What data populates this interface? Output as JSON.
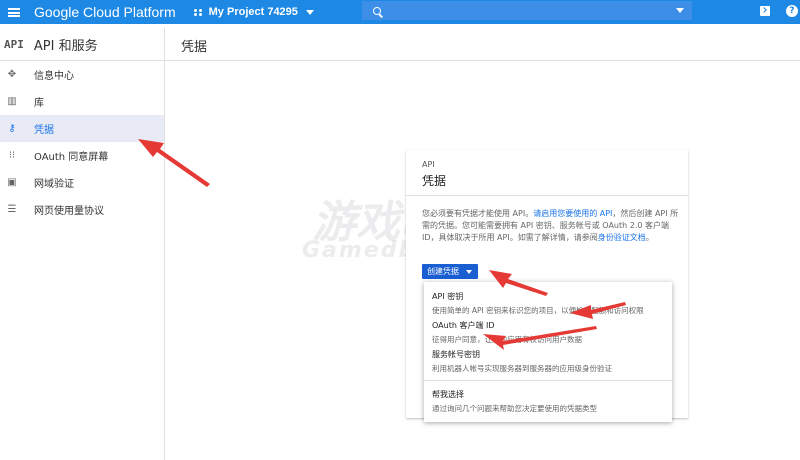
{
  "topbar": {
    "brand": "Google Cloud Platform",
    "project": "My Project 74295",
    "search_placeholder": ""
  },
  "sidebar": {
    "title": "API 和服务",
    "logo_text": "API",
    "items": [
      {
        "label": "信息中心",
        "icon": "dashboard-icon"
      },
      {
        "label": "库",
        "icon": "library-icon"
      },
      {
        "label": "凭据",
        "icon": "key-icon",
        "active": true
      },
      {
        "label": "OAuth 同意屏幕",
        "icon": "consent-icon"
      },
      {
        "label": "网域验证",
        "icon": "domain-icon"
      },
      {
        "label": "网页使用量协议",
        "icon": "settings-list-icon"
      }
    ]
  },
  "page": {
    "title": "凭据"
  },
  "card": {
    "small_label": "API",
    "title": "凭据",
    "desc_1": "您必须要有凭据才能使用 API。",
    "desc_link_1": "请启用您要使用的 API",
    "desc_2": "，然后创建 API 所需的凭据。您可能需要拥有 API 密钥、服务帐号或 OAuth 2.0 客户端 ID，具体取决于所用 API。如需了解详情，请参阅",
    "desc_link_2": "身份验证文档",
    "desc_3": "。",
    "create_button": "创建凭据"
  },
  "dropdown": {
    "items": [
      {
        "title": "API 密钥",
        "subtitle": "使用简单的 API 密钥来标识您的项目，以便检查配额和访问权限"
      },
      {
        "title": "OAuth 客户端 ID",
        "subtitle": "征得用户同意，让您的应用有权访问用户数据"
      },
      {
        "title": "服务帐号密钥",
        "subtitle": "利用机器人帐号实现服务器到服务器的应用级身份验证"
      },
      {
        "title": "帮我选择",
        "subtitle": "通过询问几个问题来帮助您决定要使用的凭据类型"
      }
    ]
  },
  "watermark": {
    "line1": "游戏吧",
    "line2": "Gamedbar"
  },
  "colors": {
    "topbar": "#1e88e5",
    "accent": "#1a73e8",
    "arrow": "#e53935"
  }
}
